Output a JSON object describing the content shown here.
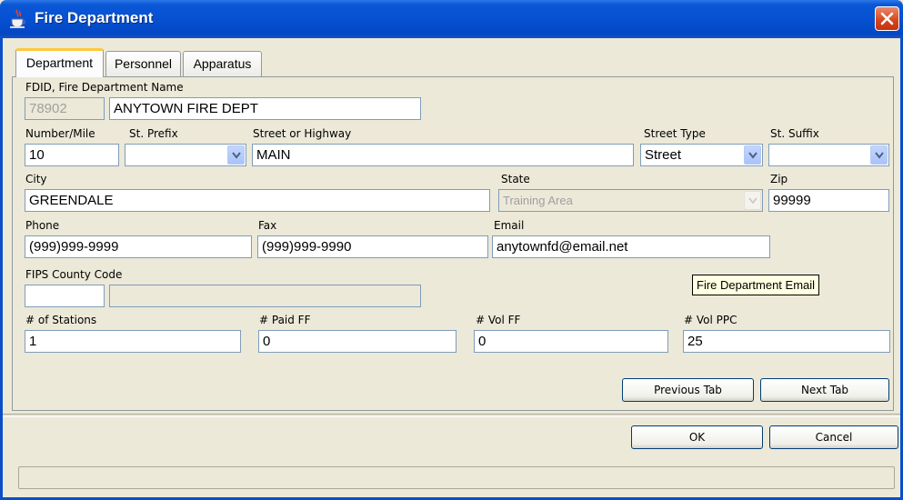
{
  "window": {
    "title": "Fire Department",
    "title_icon": "java-coffee-icon",
    "close_icon": "close-icon"
  },
  "tabs": [
    {
      "label": "Department",
      "active": true
    },
    {
      "label": "Personnel",
      "active": false
    },
    {
      "label": "Apparatus",
      "active": false
    }
  ],
  "form": {
    "fdid_name_label": "FDID, Fire Department Name",
    "fdid_value": "78902",
    "dept_name_value": "ANYTOWN FIRE DEPT",
    "number_mile_label": "Number/Mile",
    "number_mile_value": "10",
    "st_prefix_label": "St. Prefix",
    "st_prefix_value": "",
    "street_label": "Street or Highway",
    "street_value": "MAIN",
    "street_type_label": "Street Type",
    "street_type_value": "Street",
    "st_suffix_label": "St. Suffix",
    "st_suffix_value": "",
    "city_label": "City",
    "city_value": "GREENDALE",
    "state_label": "State",
    "state_value": "Training Area",
    "zip_label": "Zip",
    "zip_value": "99999",
    "phone_label": "Phone",
    "phone_value": "(999)999-9999",
    "fax_label": "Fax",
    "fax_value": "(999)999-9990",
    "email_label": "Email",
    "email_value": "anytownfd@email.net",
    "fips_label": "FIPS County Code",
    "fips_value": "",
    "fips_desc_value": "",
    "stations_label": "# of Stations",
    "stations_value": "1",
    "paid_ff_label": "# Paid FF",
    "paid_ff_value": "0",
    "vol_ff_label": "# Vol FF",
    "vol_ff_value": "0",
    "vol_ppc_label": "# Vol PPC",
    "vol_ppc_value": "25"
  },
  "tooltip": {
    "text": "Fire Department Email"
  },
  "buttons": {
    "previous_tab": "Previous Tab",
    "next_tab": "Next Tab",
    "ok": "OK",
    "cancel": "Cancel"
  },
  "status_bar": {
    "text": ""
  },
  "colors": {
    "titlebar": "#0551d2",
    "dialog_bg": "#ece9d8",
    "field_border": "#7f9db9",
    "active_tab_accent": "#ffc83c",
    "close_button": "#d5441c"
  }
}
